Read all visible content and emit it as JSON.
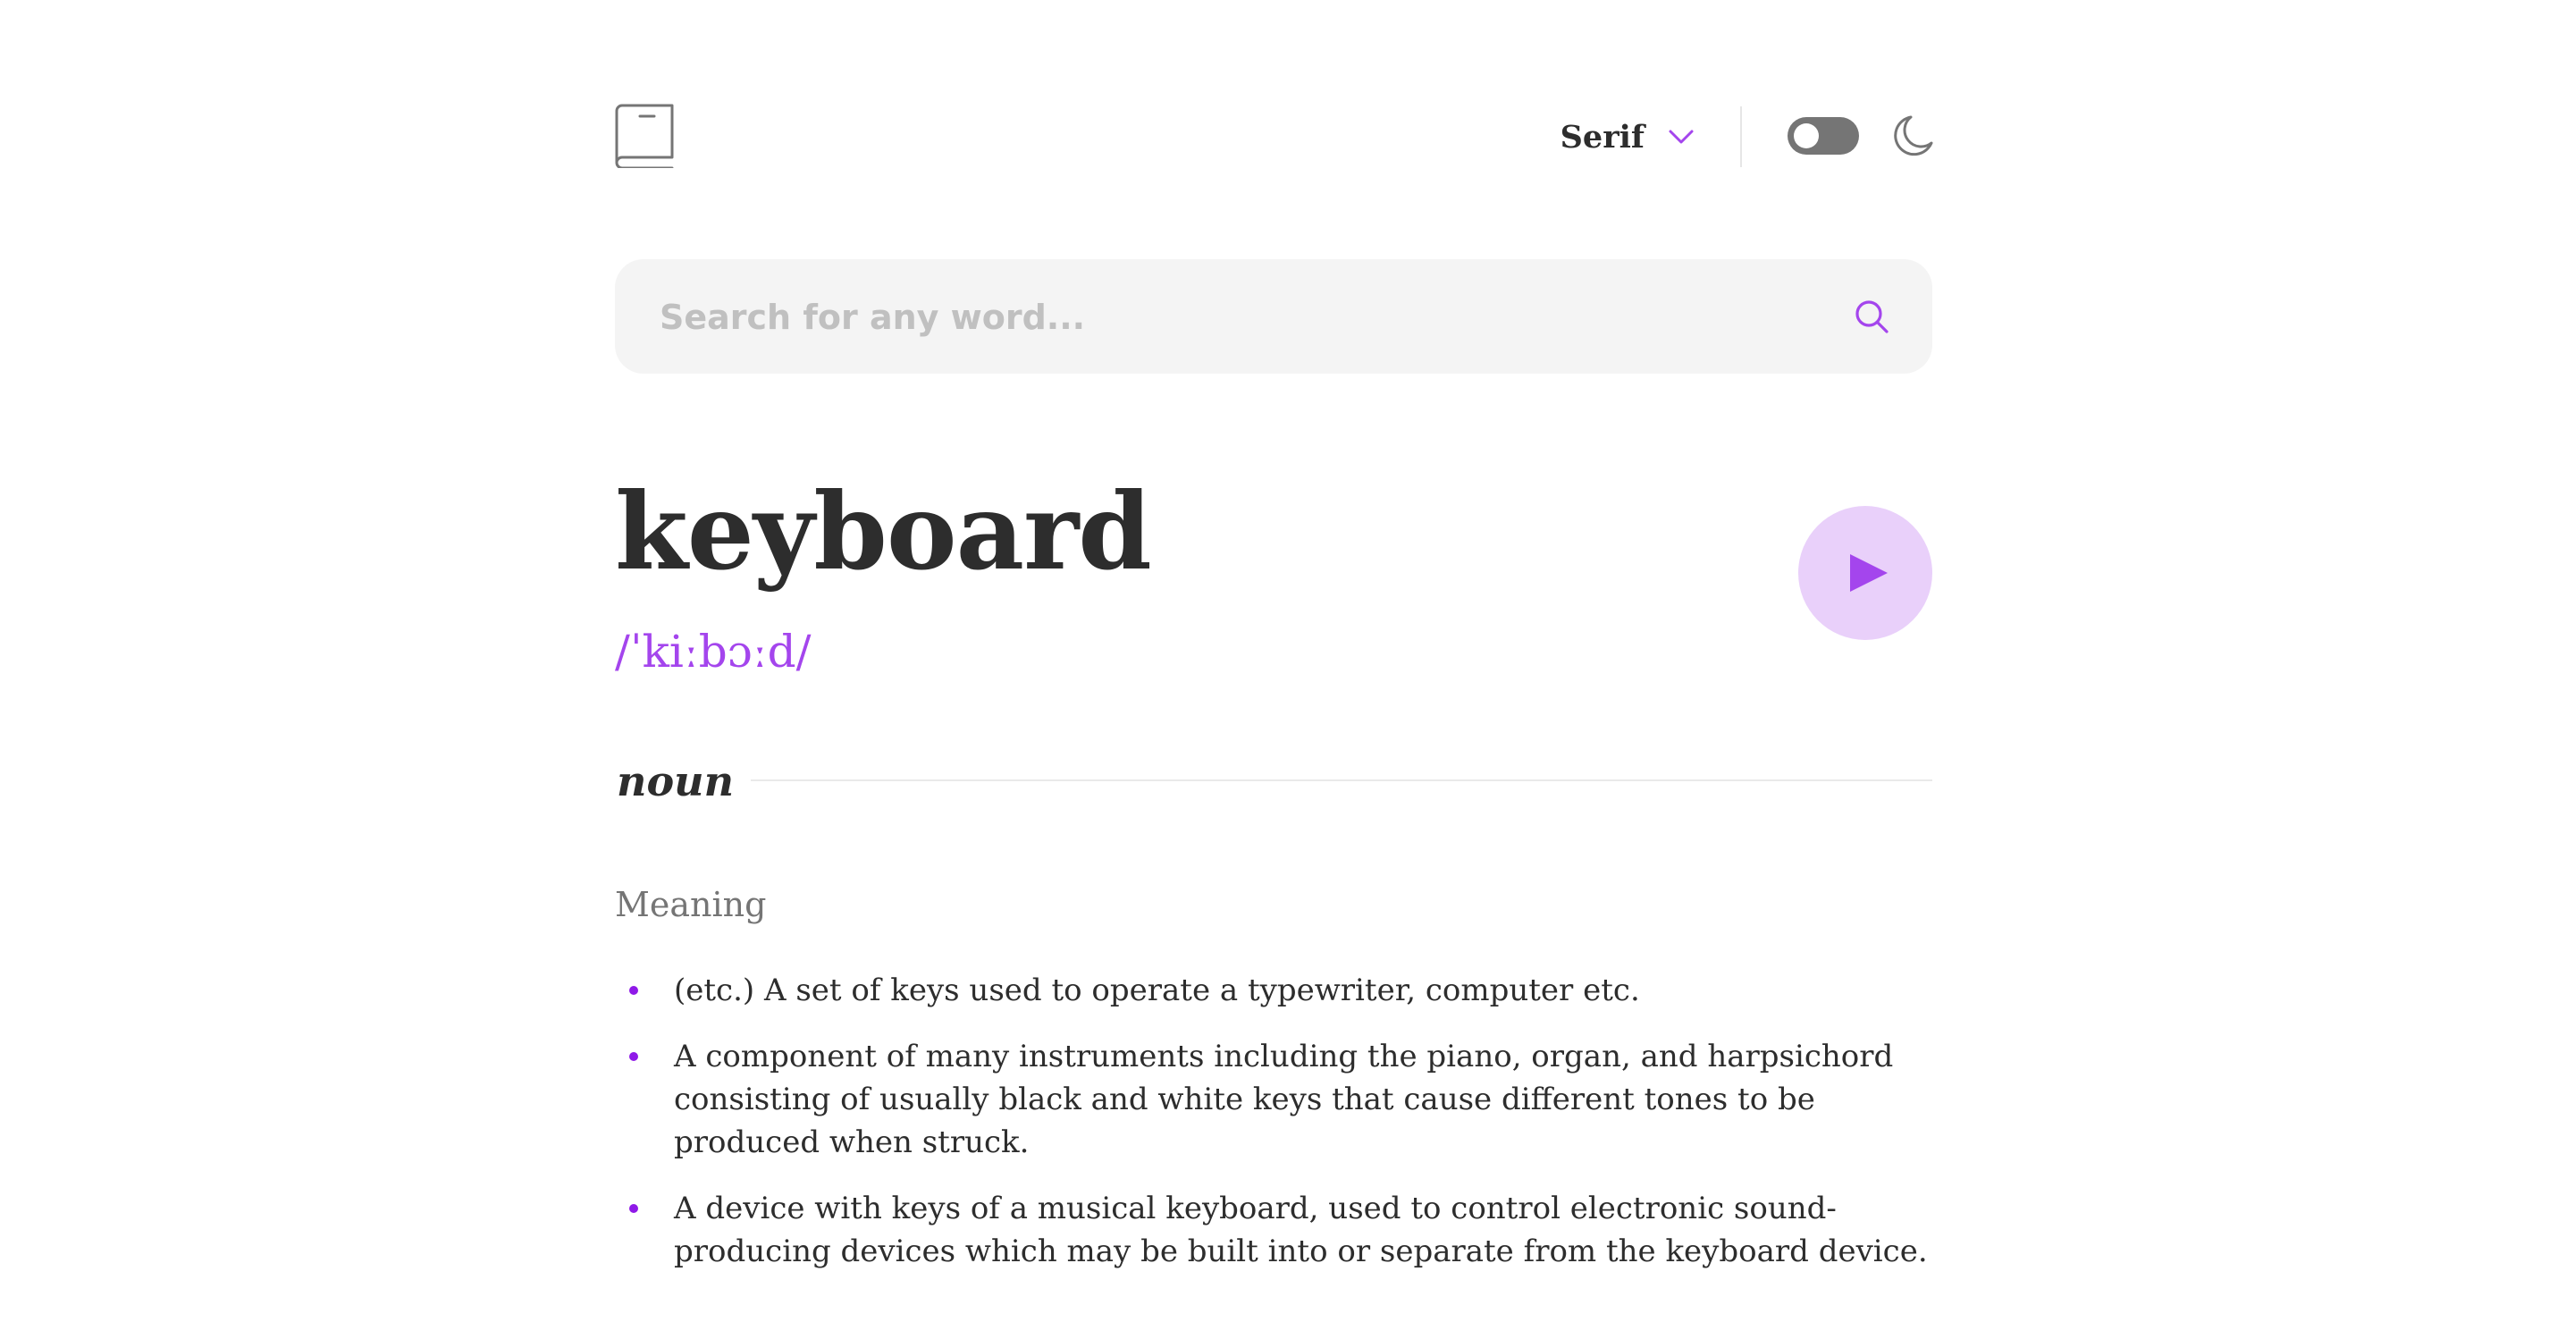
{
  "header": {
    "font_label": "Serif",
    "logo_icon": "book-icon",
    "dropdown_icon": "chevron-down-icon",
    "theme_icon": "moon-icon",
    "theme_toggle": "off"
  },
  "search": {
    "placeholder": "Search for any word...",
    "value": "",
    "icon": "search-icon"
  },
  "entry": {
    "word": "keyboard",
    "phonetic": "/ˈkiːbɔːd/",
    "play_icon": "play-icon",
    "meanings": [
      {
        "part_of_speech": "noun",
        "heading": "Meaning",
        "definitions": [
          "(etc.) A set of keys used to operate a typewriter, computer etc.",
          "A component of many instruments including the piano, organ, and harpsichord consisting of usually black and white keys that cause different tones to be produced when struck.",
          "A device with keys of a musical keyboard, used to control electronic sound-producing devices which may be built into or separate from the keyboard device."
        ]
      }
    ]
  },
  "colors": {
    "accent": "#a445ed",
    "bullet": "#8f19e8",
    "play_bg": "#e9d0fa",
    "text": "#2d2d2d",
    "muted": "#757575",
    "search_bg": "#f4f4f4"
  }
}
